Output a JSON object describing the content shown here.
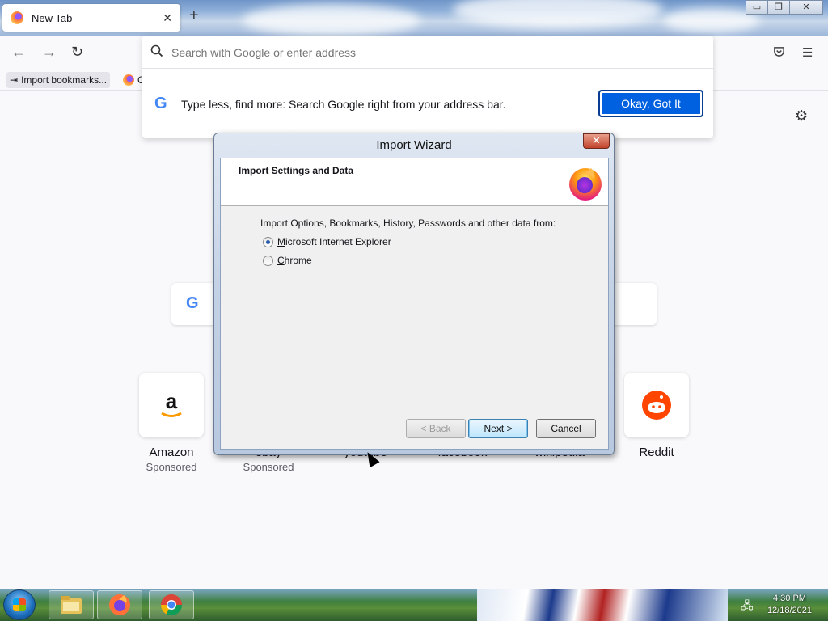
{
  "browser": {
    "tab_title": "New Tab",
    "tab_close": "✕",
    "new_tab": "+",
    "window_controls": {
      "minimize": "▭",
      "restore": "❐",
      "close": "✕"
    },
    "address_placeholder": "Search with Google or enter address",
    "bookmarks": [
      {
        "label": "Import bookmarks..."
      },
      {
        "label": "G"
      }
    ]
  },
  "url_popup": {
    "tip_text": "Type less, find more: Search Google right from your address bar.",
    "ok_button": "Okay, Got It"
  },
  "new_tab_page": {
    "sites": [
      {
        "name": "Amazon",
        "sub": "Sponsored"
      },
      {
        "name": "ebay",
        "sub": "Sponsored"
      },
      {
        "name": "youtube",
        "sub": ""
      },
      {
        "name": "facebook",
        "sub": ""
      },
      {
        "name": "wikipedia",
        "sub": ""
      },
      {
        "name": "Reddit",
        "sub": ""
      }
    ]
  },
  "wizard": {
    "title": "Import Wizard",
    "close": "✕",
    "header_title": "Import Settings and Data",
    "options_label": "Import Options, Bookmarks, History, Passwords and other data from:",
    "options": [
      {
        "underline": "M",
        "rest": "icrosoft Internet Explorer",
        "selected": true
      },
      {
        "underline": "C",
        "rest": "hrome",
        "selected": false
      }
    ],
    "buttons": {
      "back": "< Back",
      "back_ul": "B",
      "next": "Next >",
      "next_ul": "N",
      "cancel": "Cancel"
    }
  },
  "taskbar": {
    "time": "4:30 PM",
    "date": "12/18/2021"
  }
}
